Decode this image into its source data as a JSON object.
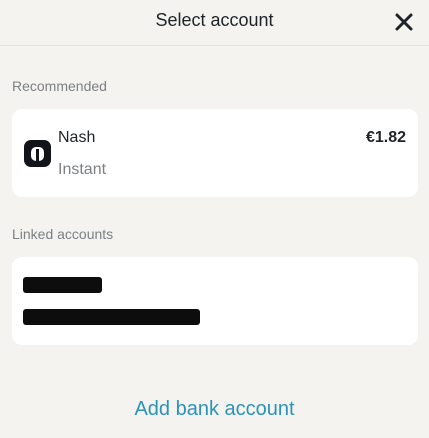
{
  "header": {
    "title": "Select account",
    "close_icon": "close-icon"
  },
  "recommended": {
    "label": "Recommended",
    "account": {
      "name": "Nash",
      "subtitle": "Instant",
      "balance": "€1.82",
      "logo_icon": "nash-logo-icon"
    }
  },
  "linked": {
    "label": "Linked accounts",
    "account": {
      "name_redacted": true,
      "detail_redacted": true
    }
  },
  "add_bank_label": "Add bank account",
  "colors": {
    "background": "#f4f3f0",
    "card": "#ffffff",
    "accent": "#2a93b8",
    "muted_text": "#7c7f84"
  }
}
